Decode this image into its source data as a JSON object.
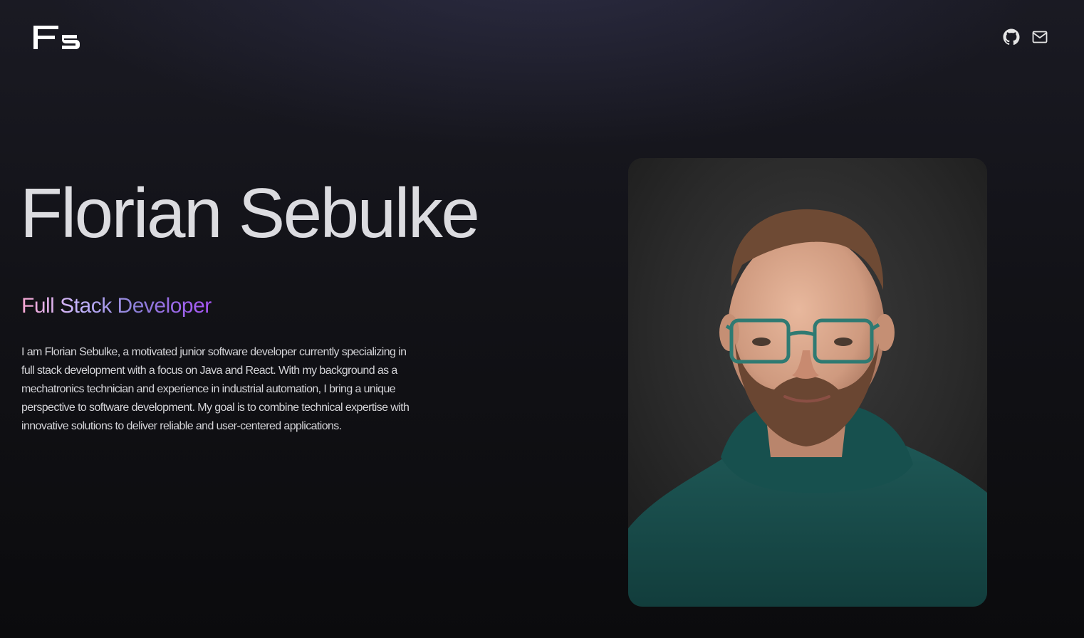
{
  "header": {
    "logo": {
      "text": "Fs",
      "icon": "fs-monogram-logo"
    },
    "social_links": [
      {
        "icon": "github-icon",
        "label": "GitHub"
      },
      {
        "icon": "mail-icon",
        "label": "Email"
      }
    ]
  },
  "hero": {
    "name": "Florian Sebulke",
    "role": "Full Stack Developer",
    "bio": "I am Florian Sebulke, a motivated junior software developer currently specializing in full stack development with a focus on Java and React. With my background as a mechatronics technician and experience in industrial automation, I bring a unique perspective to software development. My goal is to combine technical expertise with innovative solutions to deliver reliable and user-centered applications."
  },
  "portrait": {
    "alt": "Florian Sebulke"
  },
  "colors": {
    "background": "#0b0b0d",
    "text": "#e4e4e7",
    "role_gradient": [
      "#f9a8d4",
      "#c4b5fd",
      "#8b7fd6",
      "#a855f7"
    ]
  }
}
